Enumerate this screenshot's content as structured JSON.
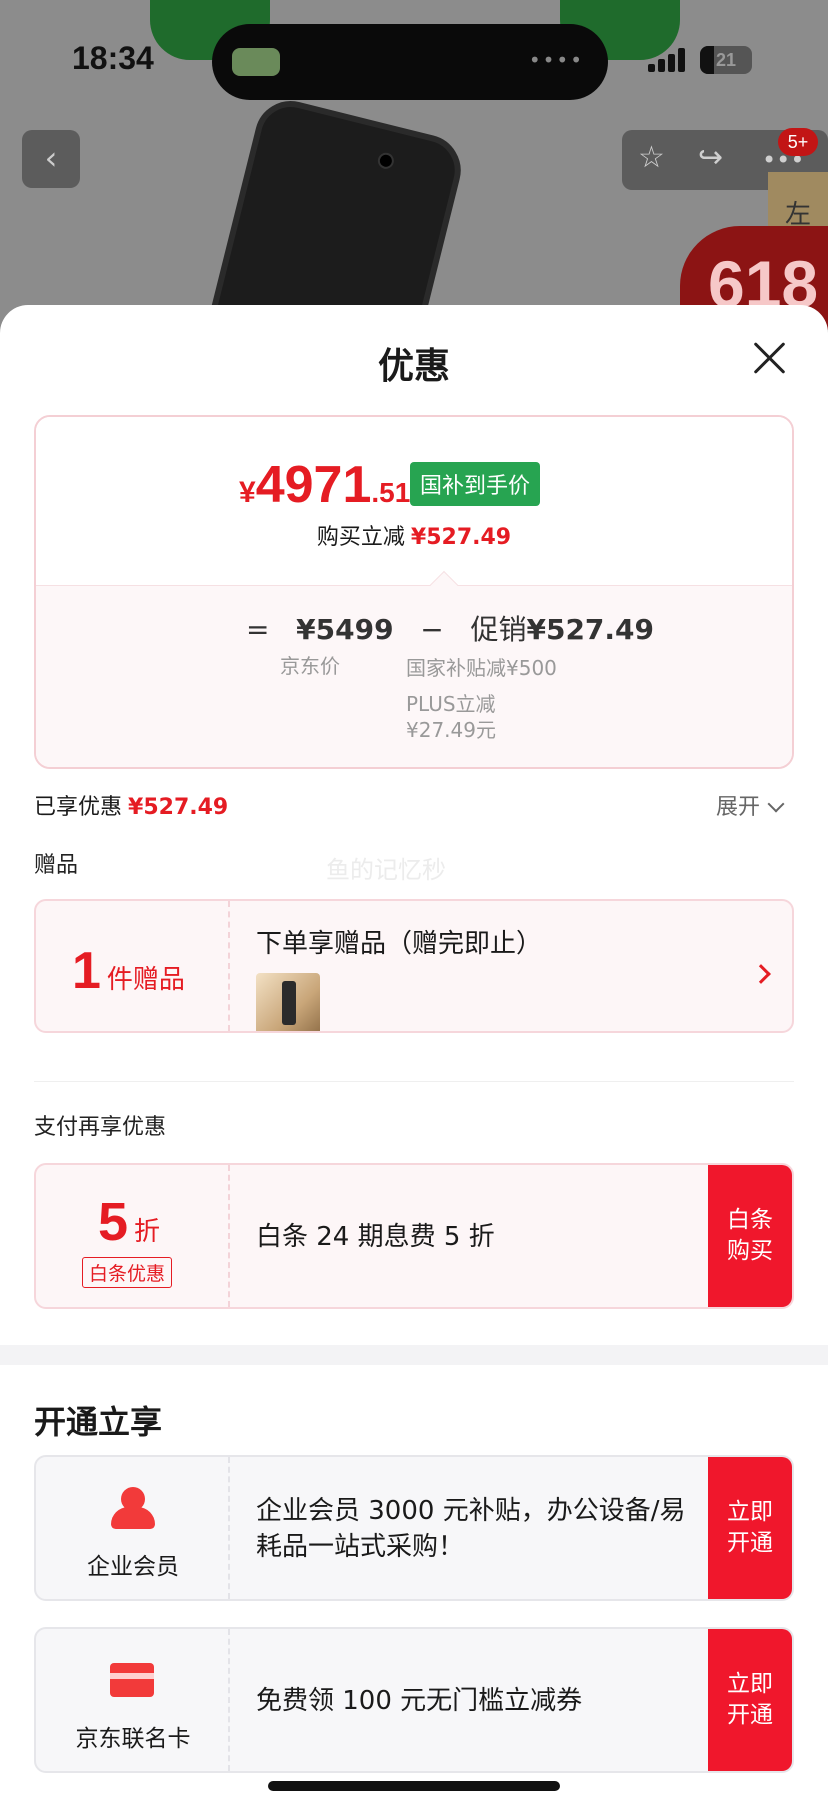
{
  "status_bar": {
    "time": "18:34",
    "battery": "21",
    "cart_badge": "5+"
  },
  "background": {
    "side_tag": "左",
    "promo": "618"
  },
  "sheet": {
    "title": "优惠",
    "price_card": {
      "currency": "¥",
      "price_int": "4971",
      "price_dec": ".51",
      "subsidy_badge": "国补到手价",
      "cut_label": "购买立减",
      "cut_amount": "¥527.49",
      "eq": "=",
      "jd_price": "¥5499",
      "minus": "−",
      "promo_label": "促销",
      "promo_amount": "¥527.49",
      "jd_price_label": "京东价",
      "national_subsidy": "国家补贴减¥500",
      "plus_label": "PLUS立减",
      "plus_amount": "¥27.49元"
    },
    "enjoyed": {
      "label": "已享优惠",
      "amount": "¥527.49",
      "expand": "展开"
    },
    "watermark": "鱼的记忆秒",
    "gift_section": {
      "label": "赠品",
      "count": "1",
      "count_unit": "件赠品",
      "title": "下单享赠品（赠完即止）"
    },
    "pay_section": {
      "label": "支付再享优惠",
      "discount": "5",
      "discount_unit": "折",
      "tag": "白条优惠",
      "text": "白条 24 期息费 5 折",
      "button": "白条购买"
    },
    "open_section": {
      "heading": "开通立享",
      "items": [
        {
          "name": "企业会员",
          "text": "企业会员 3000 元补贴，办公设备/易耗品一站式采购！",
          "button": "立即开通"
        },
        {
          "name": "京东联名卡",
          "text": "免费领 100 元无门槛立减券",
          "button": "立即开通"
        }
      ]
    }
  },
  "colors": {
    "accent": "#e51c23",
    "button": "#f0172c",
    "badge_green": "#27a451"
  },
  "icons": [
    "back-icon",
    "star-icon",
    "share-icon",
    "more-icon",
    "close-icon",
    "chevron-down-icon",
    "chevron-right-icon",
    "person-icon",
    "credit-card-icon"
  ]
}
